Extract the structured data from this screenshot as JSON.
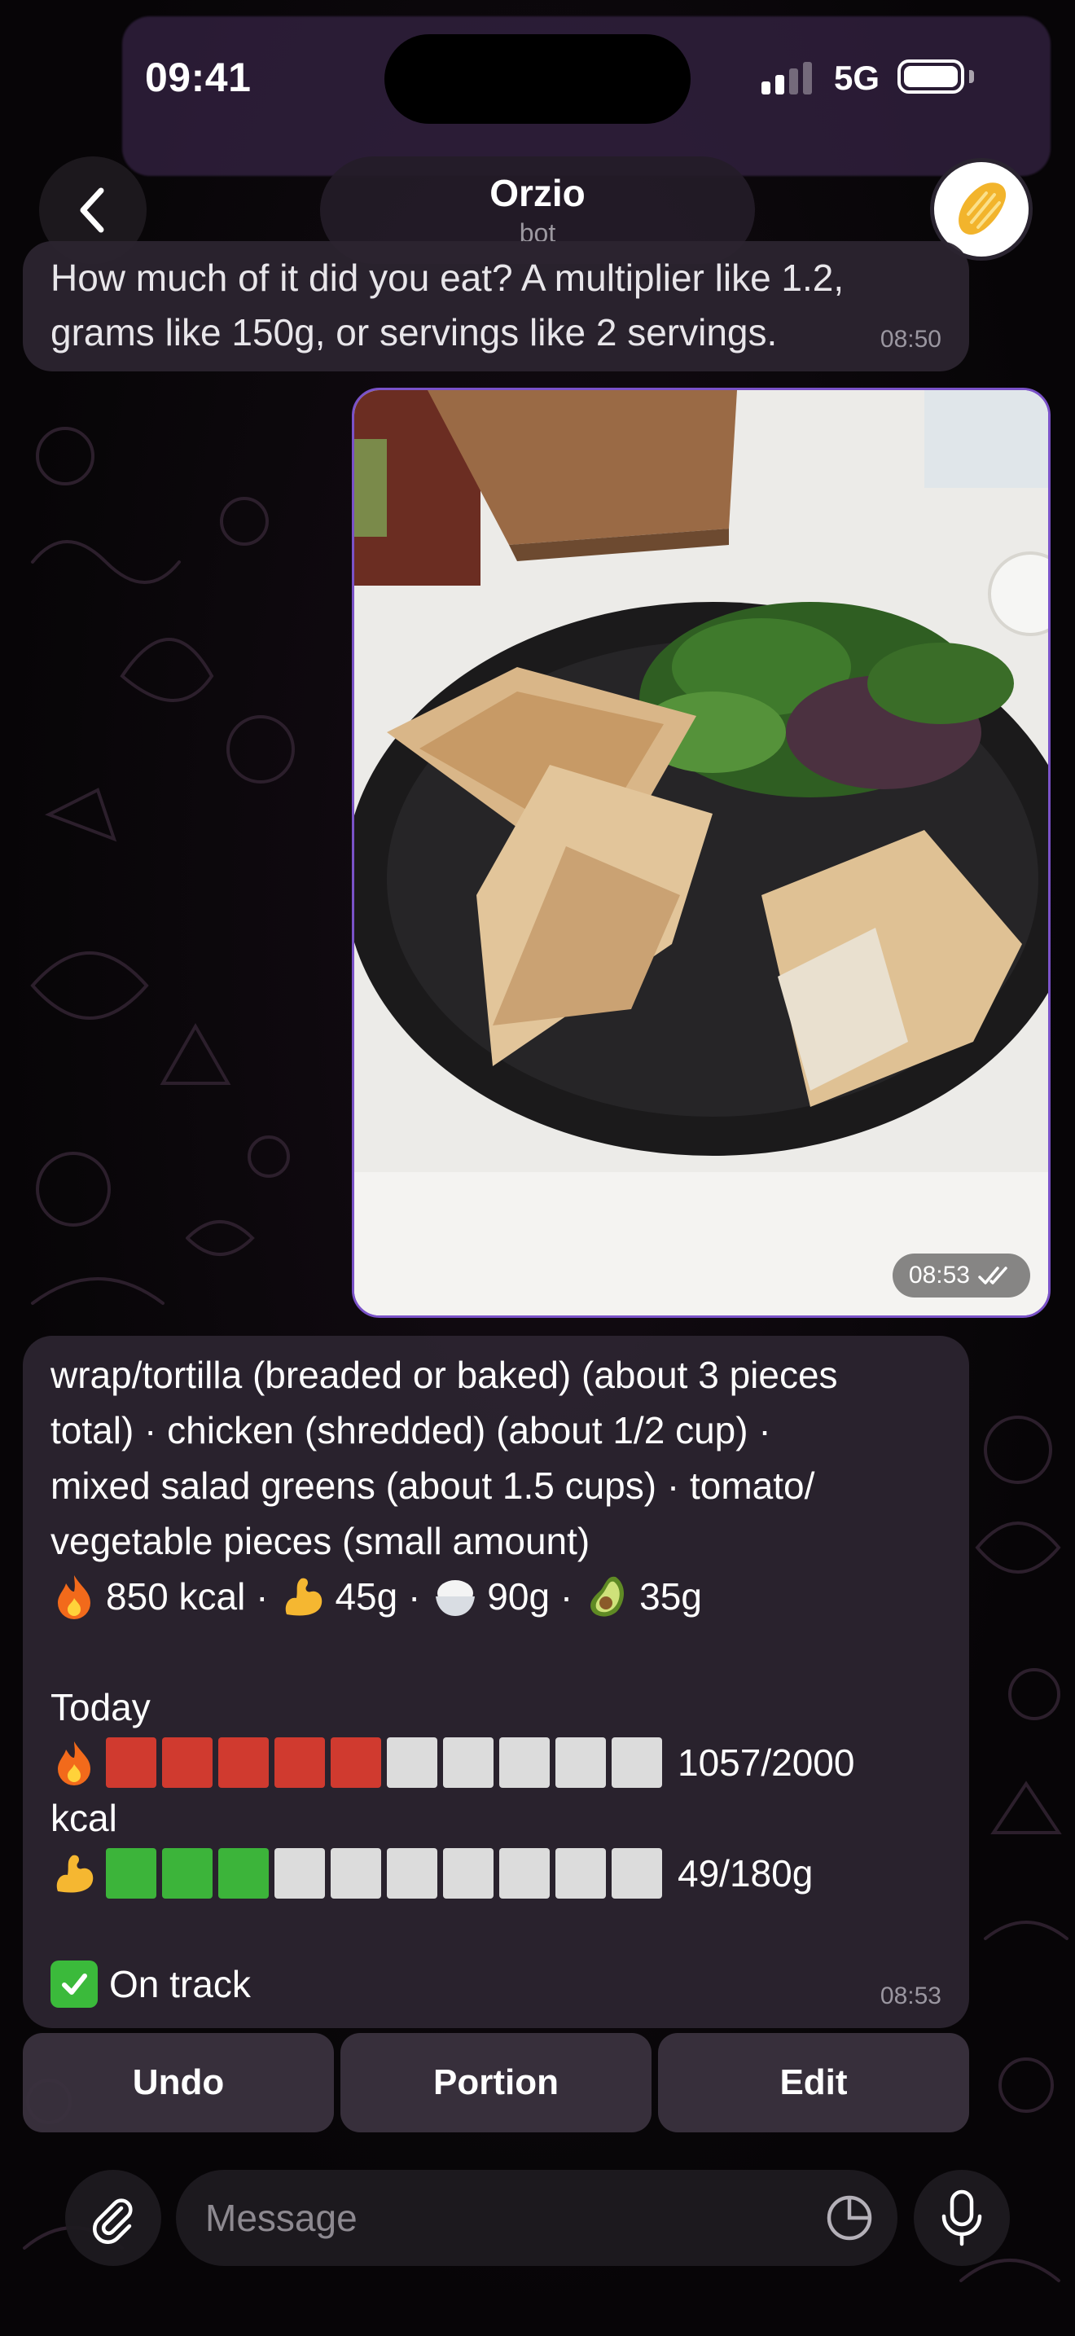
{
  "status_bar": {
    "time": "09:41",
    "network": "5G",
    "battery_level": 1.0
  },
  "header": {
    "title": "Orzio",
    "subtitle": "bot"
  },
  "messages": {
    "question": {
      "text": "How much of it did you eat? A multiplier like 1.2, grams like 150g, or servings like 2 servings.",
      "time": "08:50"
    },
    "photo": {
      "time": "08:53",
      "status_icon": "double-check-icon"
    },
    "result": {
      "lines": [
        "wrap/tortilla (breaded or baked) (about 3 pieces",
        "total) · chicken (shredded) (about 1/2 cup) ·",
        "mixed salad greens (about 1.5 cups) · tomato/",
        "vegetable pieces (small amount)"
      ],
      "kcal": "850 kcal ·",
      "protein": "45g ·",
      "carbs": "90g ·",
      "fat": "35g",
      "today_label": "Today",
      "calorie_progress": {
        "value": "1057/2000",
        "unit": "kcal",
        "filled": 5,
        "total": 10
      },
      "protein_progress": {
        "value": "49/180g",
        "filled": 3,
        "total": 10
      },
      "status": "On track",
      "time": "08:53"
    }
  },
  "keyboard": {
    "undo": "Undo",
    "portion": "Portion",
    "edit": "Edit"
  },
  "input": {
    "placeholder": "Message"
  }
}
